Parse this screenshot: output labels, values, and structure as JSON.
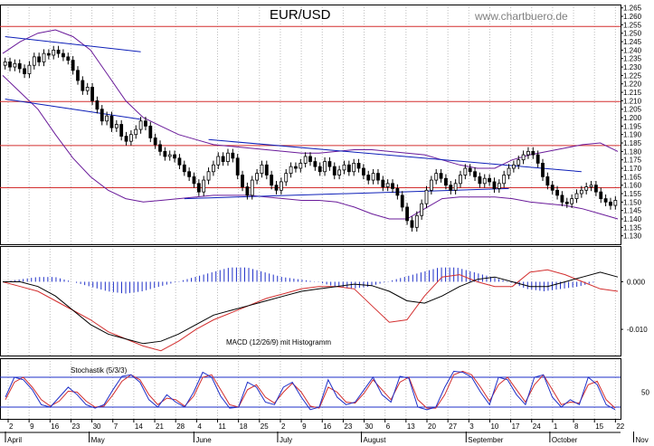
{
  "title": "EUR/USD",
  "watermark": "www.chartbuero.de",
  "colors": {
    "background": "#ffffff",
    "grid": "#bdbdbd",
    "candle": "#000000",
    "bollinger": "#6a1b9a",
    "trendline": "#0d1fb8",
    "resistance": "#d32f2f",
    "macd": "#000000",
    "signal": "#d32f2f",
    "histogram": "#1e2fc8",
    "stoch_k": "#1e2fc8",
    "stoch_d": "#d32f2f"
  },
  "chart_data": [
    {
      "type": "candlestick",
      "title": "EUR/USD",
      "x_tick_labels": [
        "2",
        "9",
        "16",
        "23",
        "30",
        "7",
        "14",
        "21",
        "28",
        "4",
        "11",
        "18",
        "25",
        "2",
        "9",
        "16",
        "23",
        "30",
        "6",
        "13",
        "20",
        "27",
        "3",
        "10",
        "17",
        "24",
        "1",
        "8",
        "15",
        "22",
        "29",
        "5"
      ],
      "month_labels": [
        "April",
        "May",
        "June",
        "July",
        "August",
        "September",
        "October",
        "Nov"
      ],
      "y_tick_labels": [
        "1.130",
        "1.135",
        "1.140",
        "1.145",
        "1.150",
        "1.155",
        "1.160",
        "1.165",
        "1.170",
        "1.175",
        "1.180",
        "1.185",
        "1.190",
        "1.195",
        "1.200",
        "1.205",
        "1.210",
        "1.215",
        "1.220",
        "1.225",
        "1.230",
        "1.235",
        "1.240",
        "1.245",
        "1.250",
        "1.255",
        "1.260",
        "1.265"
      ],
      "ylim": [
        1.125,
        1.267
      ],
      "grid": "vertical dotted",
      "close": [
        1.233,
        1.23,
        1.232,
        1.229,
        1.226,
        1.231,
        1.236,
        1.233,
        1.238,
        1.237,
        1.24,
        1.238,
        1.236,
        1.234,
        1.228,
        1.222,
        1.216,
        1.218,
        1.21,
        1.205,
        1.198,
        1.201,
        1.194,
        1.196,
        1.189,
        1.186,
        1.19,
        1.193,
        1.198,
        1.195,
        1.188,
        1.184,
        1.18,
        1.177,
        1.178,
        1.176,
        1.172,
        1.168,
        1.165,
        1.161,
        1.156,
        1.163,
        1.168,
        1.172,
        1.177,
        1.174,
        1.179,
        1.176,
        1.166,
        1.159,
        1.154,
        1.163,
        1.167,
        1.172,
        1.166,
        1.16,
        1.157,
        1.162,
        1.167,
        1.171,
        1.17,
        1.173,
        1.177,
        1.174,
        1.171,
        1.168,
        1.174,
        1.171,
        1.166,
        1.169,
        1.172,
        1.168,
        1.173,
        1.17,
        1.166,
        1.163,
        1.167,
        1.163,
        1.159,
        1.161,
        1.158,
        1.154,
        1.147,
        1.139,
        1.135,
        1.142,
        1.149,
        1.157,
        1.163,
        1.167,
        1.164,
        1.16,
        1.157,
        1.161,
        1.166,
        1.17,
        1.168,
        1.165,
        1.161,
        1.164,
        1.162,
        1.158,
        1.161,
        1.166,
        1.17,
        1.172,
        1.175,
        1.178,
        1.18,
        1.178,
        1.173,
        1.165,
        1.16,
        1.157,
        1.154,
        1.15,
        1.149,
        1.152,
        1.155,
        1.157,
        1.159,
        1.16,
        1.156,
        1.152,
        1.15,
        1.148,
        1.151
      ],
      "bollinger_upper": [
        1.238,
        1.245,
        1.25,
        1.252,
        1.248,
        1.24,
        1.225,
        1.21,
        1.2,
        1.195,
        1.19,
        1.187,
        1.184,
        1.183,
        1.182,
        1.181,
        1.18,
        1.179,
        1.179,
        1.18,
        1.181,
        1.181,
        1.18,
        1.179,
        1.178,
        1.175,
        1.172,
        1.17,
        1.17,
        1.175,
        1.178,
        1.18,
        1.182,
        1.184,
        1.185,
        1.18
      ],
      "bollinger_lower": [
        1.225,
        1.215,
        1.205,
        1.19,
        1.176,
        1.165,
        1.157,
        1.152,
        1.15,
        1.151,
        1.152,
        1.153,
        1.154,
        1.154,
        1.154,
        1.153,
        1.152,
        1.151,
        1.151,
        1.15,
        1.147,
        1.143,
        1.14,
        1.14,
        1.146,
        1.152,
        1.153,
        1.153,
        1.153,
        1.152,
        1.15,
        1.149,
        1.148,
        1.146,
        1.143,
        1.14
      ],
      "trendlines": [
        {
          "from": [
            0,
            1.248
          ],
          "to": [
            28,
            1.239
          ]
        },
        {
          "from": [
            0,
            1.211
          ],
          "to": [
            28,
            1.199
          ]
        },
        {
          "from": [
            42,
            1.187
          ],
          "to": [
            119,
            1.168
          ]
        },
        {
          "from": [
            37,
            1.152
          ],
          "to": [
            104,
            1.158
          ]
        }
      ],
      "resistance_levels": [
        1.254,
        1.2095,
        1.1835,
        1.1585
      ]
    },
    {
      "type": "line",
      "label": "MACD (12/26/9) mit Histogramm",
      "y_tick_labels": [
        "0.000",
        "-0.010"
      ],
      "ylim": [
        -0.0155,
        0.0075
      ],
      "macd": [
        0.0,
        0.0,
        -0.001,
        -0.003,
        -0.006,
        -0.009,
        -0.011,
        -0.012,
        -0.013,
        -0.0125,
        -0.011,
        -0.009,
        -0.007,
        -0.006,
        -0.005,
        -0.004,
        -0.003,
        -0.002,
        -0.0015,
        -0.001,
        -0.0005,
        -0.0008,
        -0.002,
        -0.004,
        -0.0045,
        -0.003,
        -0.001,
        0.0005,
        0.001,
        0.0,
        -0.001,
        -0.001,
        0.0,
        0.001,
        0.002,
        0.001
      ],
      "signal": [
        0.0,
        -0.001,
        -0.002,
        -0.004,
        -0.006,
        -0.008,
        -0.0105,
        -0.012,
        -0.0135,
        -0.0145,
        -0.0125,
        -0.01,
        -0.008,
        -0.0065,
        -0.005,
        -0.0035,
        -0.0025,
        -0.0015,
        -0.001,
        -0.001,
        -0.0015,
        -0.005,
        -0.0085,
        -0.008,
        -0.003,
        0.001,
        0.0015,
        0.0,
        -0.001,
        -0.001,
        0.002,
        0.0025,
        0.0015,
        0.0,
        -0.0015,
        -0.002
      ],
      "histogram": [
        0.0,
        0.0005,
        0.001,
        0.001,
        0.0,
        -0.001,
        -0.002,
        -0.0025,
        -0.002,
        -0.001,
        0.0,
        0.001,
        0.002,
        0.003,
        0.003,
        0.002,
        0.001,
        0.0005,
        0.0,
        -0.001,
        -0.0015,
        -0.001,
        0.0,
        0.001,
        0.002,
        0.003,
        0.003,
        0.002,
        0.001,
        0.0,
        -0.0015,
        -0.002,
        -0.0015,
        -0.001,
        0.0,
        0.0
      ]
    },
    {
      "type": "line",
      "label": "Stochastik (5/3/3)",
      "y_tick_labels": [
        "50"
      ],
      "ylim": [
        0,
        100
      ],
      "reference_lines": [
        80,
        20
      ],
      "k": [
        40,
        80,
        75,
        55,
        25,
        20,
        40,
        60,
        45,
        25,
        18,
        25,
        55,
        82,
        85,
        70,
        35,
        20,
        45,
        30,
        20,
        50,
        90,
        80,
        42,
        18,
        20,
        70,
        60,
        30,
        25,
        60,
        70,
        40,
        15,
        20,
        75,
        40,
        25,
        30,
        55,
        80,
        45,
        30,
        82,
        78,
        20,
        15,
        20,
        60,
        92,
        90,
        80,
        50,
        25,
        80,
        75,
        45,
        25,
        80,
        85,
        40,
        20,
        35,
        25,
        80,
        65,
        25,
        15
      ],
      "d": [
        35,
        70,
        80,
        60,
        35,
        22,
        32,
        52,
        50,
        32,
        20,
        22,
        45,
        72,
        85,
        75,
        45,
        25,
        38,
        35,
        22,
        42,
        80,
        85,
        55,
        25,
        20,
        55,
        65,
        40,
        28,
        50,
        68,
        50,
        22,
        18,
        60,
        50,
        30,
        28,
        48,
        75,
        55,
        35,
        70,
        80,
        35,
        18,
        18,
        45,
        85,
        92,
        85,
        60,
        32,
        65,
        80,
        55,
        30,
        65,
        85,
        55,
        25,
        30,
        28,
        65,
        72,
        35,
        18
      ]
    }
  ]
}
